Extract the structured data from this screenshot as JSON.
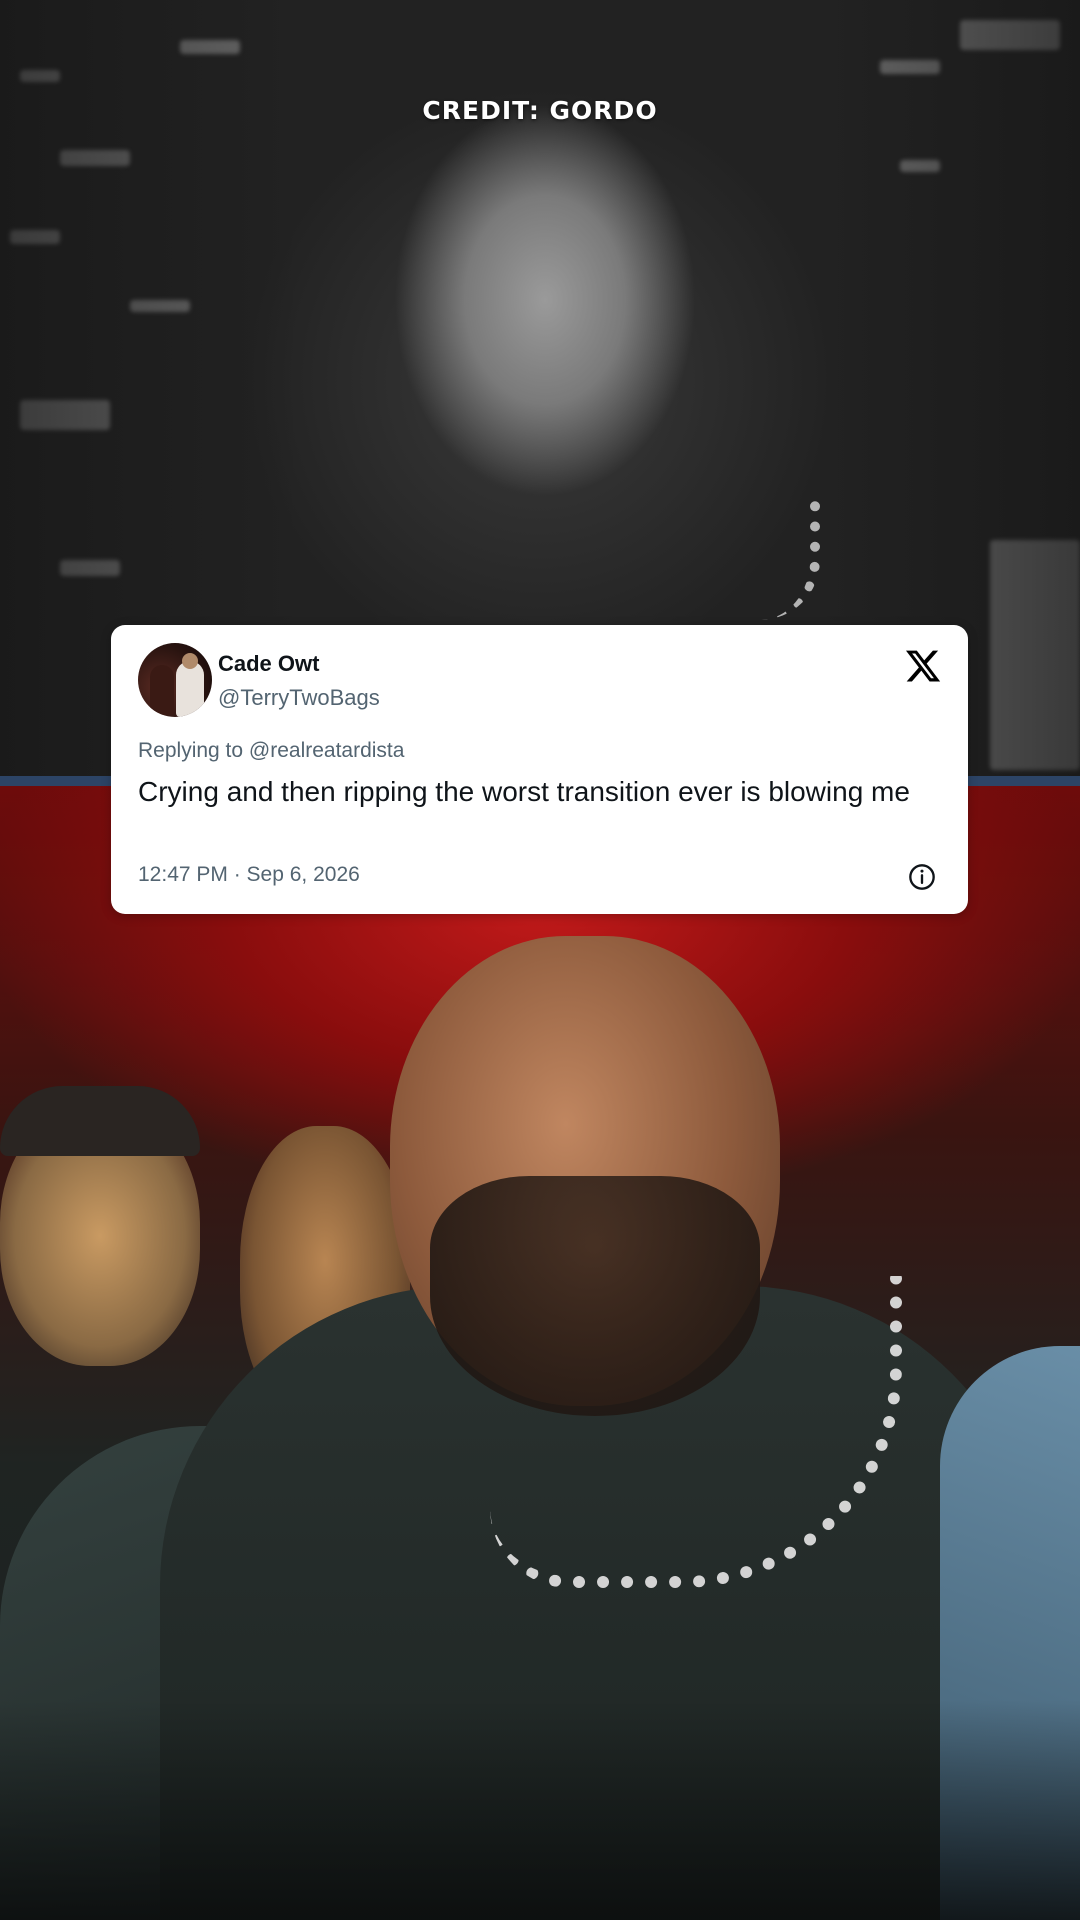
{
  "overlay": {
    "credit": "CREDIT: GORDO"
  },
  "tweet": {
    "display_name": "Cade Owt",
    "handle": "@TerryTwoBags",
    "reply_to": "Replying to @realreatardista",
    "text": "Crying and then ripping the worst transition ever is blowing me",
    "timestamp": "12:47 PM · Sep 6, 2026",
    "platform_icon": "x-logo-icon",
    "info_icon": "info-icon"
  },
  "colors": {
    "divider": "#2c4466",
    "card_bg": "#ffffff",
    "name_text": "#0f1419",
    "secondary_text": "#536471"
  }
}
